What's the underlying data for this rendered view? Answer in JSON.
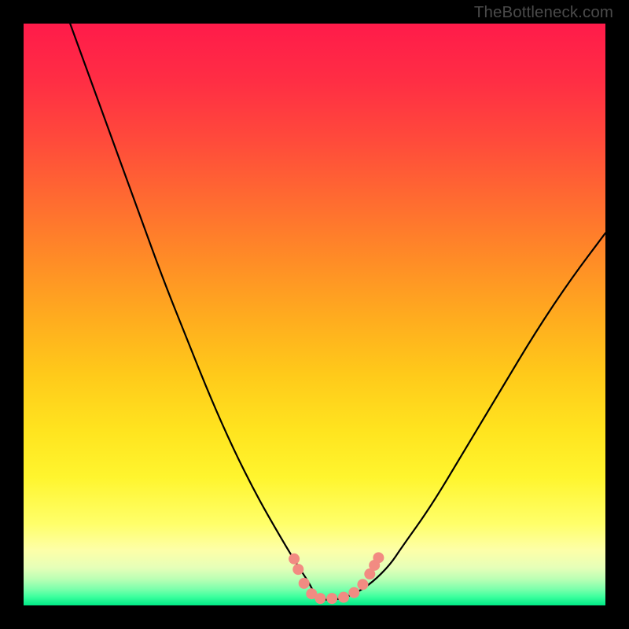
{
  "watermark": "TheBottleneck.com",
  "gradient": {
    "stops": [
      {
        "offset": 0.0,
        "color": "#ff1b4a"
      },
      {
        "offset": 0.1,
        "color": "#ff2e44"
      },
      {
        "offset": 0.2,
        "color": "#ff4a3b"
      },
      {
        "offset": 0.3,
        "color": "#ff6a31"
      },
      {
        "offset": 0.4,
        "color": "#ff8a27"
      },
      {
        "offset": 0.5,
        "color": "#ffaa1f"
      },
      {
        "offset": 0.6,
        "color": "#ffc91a"
      },
      {
        "offset": 0.7,
        "color": "#ffe41f"
      },
      {
        "offset": 0.78,
        "color": "#fff52e"
      },
      {
        "offset": 0.86,
        "color": "#ffff6a"
      },
      {
        "offset": 0.905,
        "color": "#fdffa8"
      },
      {
        "offset": 0.935,
        "color": "#e6ffb8"
      },
      {
        "offset": 0.955,
        "color": "#b9ffb4"
      },
      {
        "offset": 0.972,
        "color": "#7cffac"
      },
      {
        "offset": 0.985,
        "color": "#3dff9e"
      },
      {
        "offset": 1.0,
        "color": "#00e986"
      }
    ]
  },
  "chart_data": {
    "type": "line",
    "title": "",
    "xlabel": "",
    "ylabel": "",
    "xlim": [
      0,
      100
    ],
    "ylim": [
      0,
      100
    ],
    "series": [
      {
        "name": "bottleneck-curve",
        "x": [
          8,
          12,
          16,
          20,
          24,
          28,
          32,
          36,
          40,
          44,
          47,
          49,
          50,
          51,
          52,
          54,
          57,
          60,
          63,
          65,
          70,
          76,
          82,
          88,
          94,
          100
        ],
        "y": [
          100,
          89,
          78,
          67,
          56,
          46,
          36,
          27,
          19,
          12,
          7,
          4,
          2,
          1,
          1,
          1,
          2,
          4,
          7,
          10,
          17,
          27,
          37,
          47,
          56,
          64
        ]
      }
    ],
    "markers": {
      "name": "highlight-dots",
      "x": [
        46.5,
        47.2,
        48.2,
        49.5,
        51.0,
        53.0,
        55.0,
        56.8,
        58.3,
        59.5,
        60.3,
        61.0
      ],
      "y": [
        8.0,
        6.2,
        3.8,
        2.0,
        1.2,
        1.2,
        1.4,
        2.2,
        3.6,
        5.4,
        6.9,
        8.2
      ]
    },
    "marker_color": "#f28b82",
    "curve_color": "#000000"
  }
}
